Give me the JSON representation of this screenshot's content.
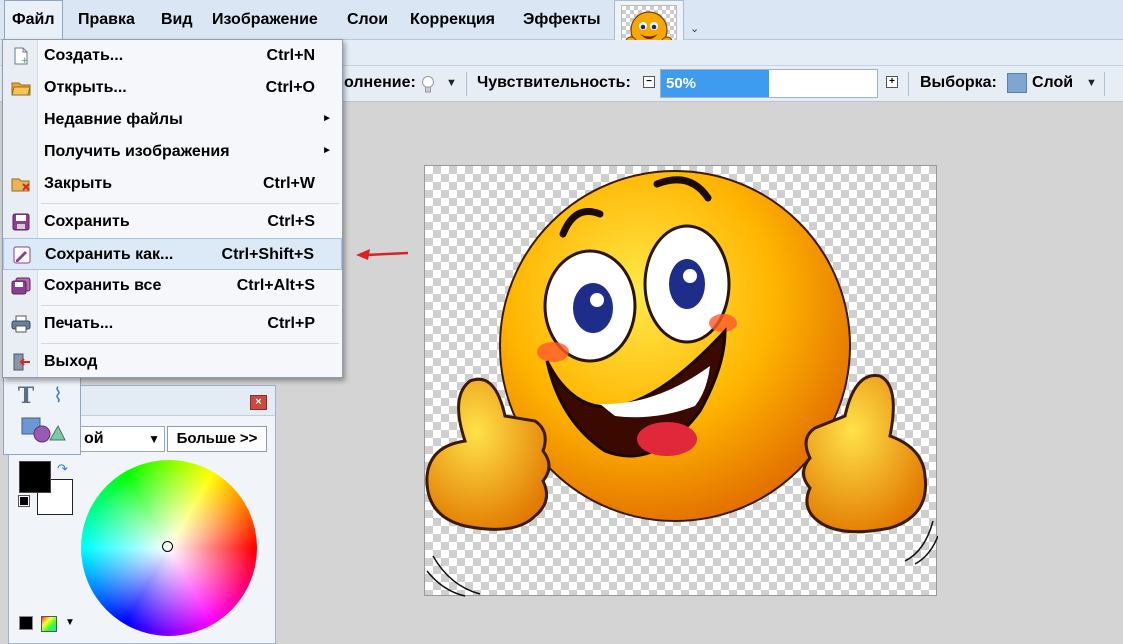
{
  "menubar": {
    "items": [
      "Файл",
      "Правка",
      "Вид",
      "Изображение",
      "Слои",
      "Коррекция",
      "Эффекты"
    ]
  },
  "toolbar": {
    "fill_label": "олнение:",
    "sensitivity_label": "Чувствительность:",
    "sensitivity_value": "50%",
    "sensitivity_level": 0.5,
    "selection_label": "Выборка:",
    "selection_value": "Слой"
  },
  "file_menu": {
    "items": [
      {
        "label": "Создать...",
        "shortcut": "Ctrl+N",
        "icon": "new-file-icon"
      },
      {
        "label": "Открыть...",
        "shortcut": "Ctrl+O",
        "icon": "open-folder-icon"
      },
      {
        "label": "Недавние файлы",
        "shortcut": "",
        "icon": "",
        "submenu": true
      },
      {
        "label": "Получить изображения",
        "shortcut": "",
        "icon": "",
        "submenu": true
      },
      {
        "label": "Закрыть",
        "shortcut": "Ctrl+W",
        "icon": "close-file-icon"
      },
      {
        "label": "Сохранить",
        "shortcut": "Ctrl+S",
        "icon": "save-icon"
      },
      {
        "label": "Сохранить как...",
        "shortcut": "Ctrl+Shift+S",
        "icon": "save-as-icon",
        "highlighted": true
      },
      {
        "label": "Сохранить все",
        "shortcut": "Ctrl+Alt+S",
        "icon": "save-all-icon"
      },
      {
        "label": "Печать...",
        "shortcut": "Ctrl+P",
        "icon": "print-icon"
      },
      {
        "label": "Выход",
        "shortcut": "",
        "icon": "exit-icon"
      }
    ]
  },
  "colors_panel": {
    "mode_label": "ой",
    "more_button": "Больше >>",
    "primary_color": "#000000",
    "secondary_color": "#ffffff"
  },
  "colors": {
    "menubar_bg": "#dae6f3",
    "highlight": "#dce9f6",
    "accent": "#3d9cf0",
    "arrow": "#e02020"
  }
}
